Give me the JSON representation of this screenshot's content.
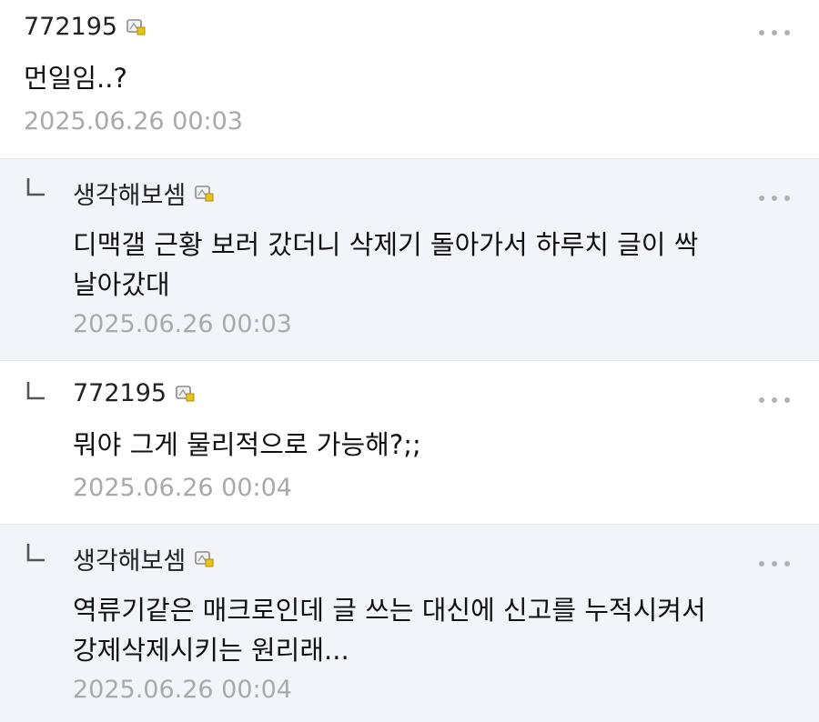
{
  "comments": [
    {
      "author": "772195",
      "body_lines": [
        "먼일임..?"
      ],
      "timestamp": "2025.06.26 00:03",
      "is_reply": false
    },
    {
      "author": "생각해보셈",
      "body_lines": [
        "디맥갤 근황 보러 갔더니 삭제기 돌아가서 하루치 글이 싹",
        "날아갔대"
      ],
      "timestamp": "2025.06.26 00:03",
      "is_reply": true
    },
    {
      "author": "772195",
      "body_lines": [
        "뭐야 그게 물리적으로 가능해?;;"
      ],
      "timestamp": "2025.06.26 00:04",
      "is_reply": true
    },
    {
      "author": "생각해보셈",
      "body_lines": [
        "역류기같은 매크로인데 글 쓰는 대신에 신고를 누적시켜서",
        "강제삭제시키는 원리래..."
      ],
      "timestamp": "2025.06.26 00:04",
      "is_reply": true
    }
  ],
  "icons": {
    "badge": "user-badge-icon",
    "more": "more-options-icon",
    "reply": "reply-arrow-icon"
  },
  "colors": {
    "reply_background": "#f3f4fa",
    "timestamp": "#a9a9ad",
    "badge_accent": "#e8c21c"
  }
}
